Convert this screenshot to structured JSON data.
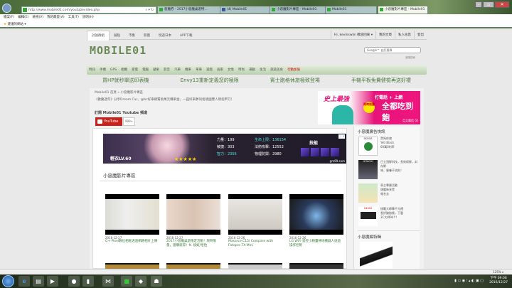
{
  "browser": {
    "url": "http://www.mobile01.com/youtubevideo.php",
    "addr_controls": "⌕ ▾ ↻",
    "tabs": [
      {
        "label": "惡魔券 - 2017小惡魔桌遊特..."
      },
      {
        "label": "(4) Mobile01"
      },
      {
        "label": "小惡魔影片專區 - Mobile01"
      },
      {
        "label": "Mobile01"
      },
      {
        "label": "小惡魔影片專區 - Mobile01"
      }
    ],
    "menu": [
      "檔案(F)",
      "編輯(E)",
      "檢視(V)",
      "我的最愛(A)",
      "工具(T)",
      "說明(H)"
    ],
    "favorites_label": "建議的網站 ▾",
    "zoom": "125% ▾"
  },
  "topnav": {
    "items": [
      "討論群組",
      "展點",
      "市集",
      "影圖",
      "悅遊日本",
      "APP下載"
    ],
    "right": [
      "Hi, kevinswlin 歡迎回來 ▾",
      "我的文章",
      "私人訊息",
      "登出"
    ]
  },
  "logo": "MOBILE01",
  "search": {
    "placeholder": "自訂搜尋",
    "advanced": "進階搜尋"
  },
  "categories": [
    "時訊",
    "手機",
    "GPS",
    "相機",
    "家電",
    "電腦",
    "蘋果",
    "影音",
    "汽車",
    "機車",
    "單車",
    "遊戲",
    "居家",
    "女性",
    "時尚",
    "運動",
    "生活",
    "旅遊美食",
    "行動加值"
  ],
  "promos": [
    "買HP就秒單送印表機",
    "Envy13重新定義您的極限",
    "賓士跑格休旅極致登場",
    "手機平板免費健檢再送好禮"
  ],
  "breadcrumb": "Mobile01 首頁 » 小惡魔影片專區",
  "subtitle": "《歡慶週年》分享Dream Car，@bc好車網贊助萬元購車金，一圓好車夢同捨德國雙人牌指甲刀！",
  "subscribe": {
    "label": "訂閱 Mobile01 Youtube 頻道",
    "button": "YouTube",
    "count": "999+"
  },
  "right_ad": {
    "headline": "史上最強",
    "line1": "打電話 + 上網",
    "line2": "全都吃到飽",
    "badge": "限時限量",
    "brand": "亞太電信 Gt"
  },
  "game_ad": {
    "name": "輕衣LV.60",
    "stats": [
      "力量：199",
      "生命上限：136154",
      "敏捷：303",
      "法術攻擊：12552",
      "智力：2356",
      "物理防禦：2980"
    ],
    "skill": "技能",
    "site": "gm99.com",
    "controls": "ⓘ ✕"
  },
  "section_title": "小惡魔影片專區",
  "videos": [
    {
      "date": "2016-12-27",
      "title": "G+ Pixel數位相框透過網路相片上傳"
    },
    {
      "date": "2016-12-27",
      "title": "2017小惡魔桌遊限定活動！限時限量，搶購就得！ft. 奴奴/恰恰"
    },
    {
      "date": "2016-12-26",
      "title": "Masarce C15i Compare with Fotopro TX-Mini"
    },
    {
      "date": "2016-12-26",
      "title": "LG WiFi 遙控小精靈掃地機器人透過操作控制"
    }
  ],
  "sidebar": {
    "ad_title": "小惡魔廣告快訊",
    "ads": [
      {
        "brand": "SKODA",
        "text": [
          "黑馬休旅",
          "Yeti Black",
          "60萬0利率"
        ]
      },
      {
        "brand": "HITACHI",
        "text": [
          "日立頂鮮科技，長效保鮮，封存鮮",
          "味，營養不流失！"
        ]
      },
      {
        "brand": "",
        "text": [
          "車主專屬活動",
          "旗艦新享受",
          "報名去"
        ]
      },
      {
        "brand": "G4000",
        "text": [
          "挑戰大師筆千元禮",
          "卷評論給獎，下載",
          "3C大師94!!!"
        ]
      }
    ],
    "special_title": "小惡魔編特輯"
  },
  "taskbar": {
    "time": "下午 09:06",
    "date": "2016/12/27"
  }
}
